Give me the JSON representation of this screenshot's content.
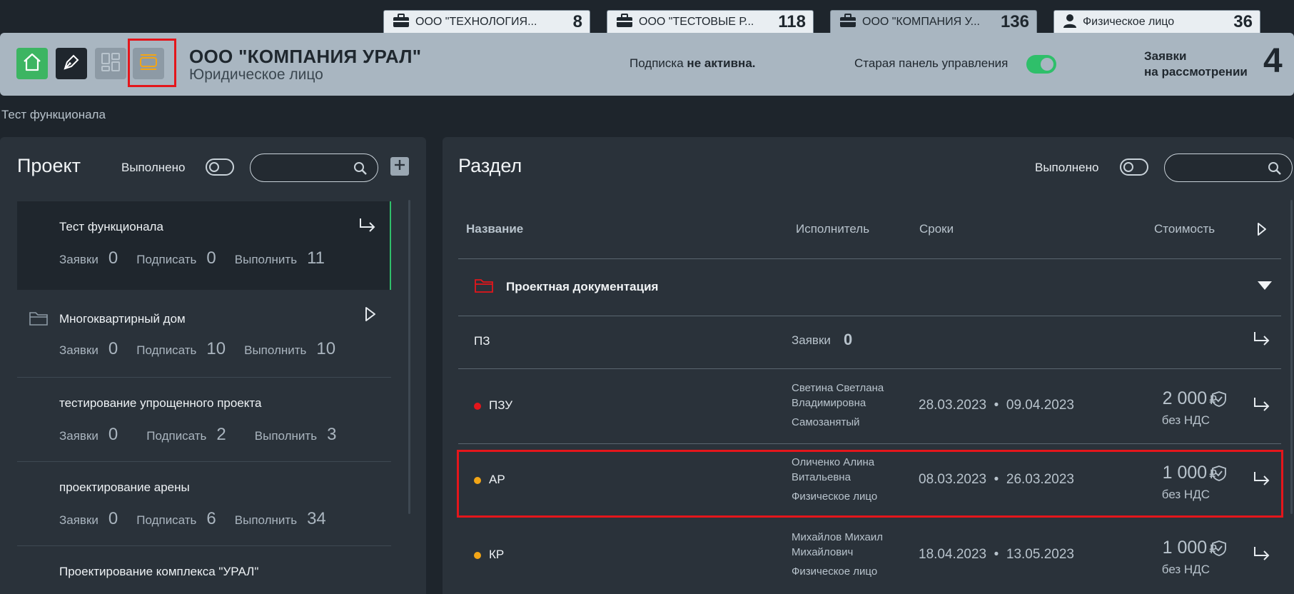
{
  "org_tabs": [
    {
      "name": "ООО \"ТЕХНОЛОГИЯ...",
      "count": "8",
      "icon": "briefcase-icon",
      "active": false
    },
    {
      "name": "ООО \"ТЕСТОВЫЕ Р...",
      "count": "118",
      "icon": "briefcase-icon",
      "active": false
    },
    {
      "name": "ООО \"КОМПАНИЯ У...",
      "count": "136",
      "icon": "briefcase-icon",
      "active": true
    },
    {
      "name": "Физическое лицо",
      "count": "36",
      "icon": "person-icon",
      "active": false
    }
  ],
  "header": {
    "org_name": "ООО \"КОМПАНИЯ УРАЛ\"",
    "org_type": "Юридическое лицо",
    "subscription_prefix": "Подписка",
    "subscription_status": "не активна.",
    "old_panel_label": "Старая панель управления",
    "requests_label_1": "Заявки",
    "requests_label_2": "на рассмотрении",
    "requests_count": "4",
    "buttons": [
      "home-icon",
      "pen-icon",
      "dashboard-grid-icon",
      "card-view-icon"
    ]
  },
  "breadcrumb": "Тест функционала",
  "project_panel": {
    "title": "Проект",
    "done_label": "Выполнено",
    "search_placeholder": "",
    "items": [
      {
        "name": "Тест функционала",
        "requests_label": "Заявки",
        "requests": "0",
        "sign_label": "Подписать",
        "sign": "0",
        "do_label": "Выполнить",
        "do": "11",
        "selected": true,
        "folder": false
      },
      {
        "name": "Многоквартирный дом",
        "requests_label": "Заявки",
        "requests": "0",
        "sign_label": "Подписать",
        "sign": "10",
        "do_label": "Выполнить",
        "do": "10",
        "selected": false,
        "folder": true
      },
      {
        "name": "тестирование упрощенного проекта",
        "requests_label": "Заявки",
        "requests": "0",
        "sign_label": "Подписать",
        "sign": "2",
        "do_label": "Выполнить",
        "do": "3",
        "selected": false,
        "folder": false
      },
      {
        "name": "проектирование арены",
        "requests_label": "Заявки",
        "requests": "0",
        "sign_label": "Подписать",
        "sign": "6",
        "do_label": "Выполнить",
        "do": "34",
        "selected": false,
        "folder": false
      },
      {
        "name": "Проектирование комплекса \"УРАЛ\"",
        "selected": false,
        "folder": false
      }
    ]
  },
  "section_panel": {
    "title": "Раздел",
    "done_label": "Выполнено",
    "search_placeholder": "",
    "columns": {
      "name": "Название",
      "executor": "Исполнитель",
      "terms": "Сроки",
      "cost": "Стоимость"
    },
    "group": "Проектная документация",
    "pz": {
      "name": "ПЗ",
      "requests_label": "Заявки",
      "requests": "0"
    },
    "rows": [
      {
        "name": "ПЗУ",
        "status_color": "#e4161b",
        "executor_1": "Светина Светлана",
        "executor_2": "Владимировна",
        "executor_type": "Самозанятый",
        "date_from": "28.03.2023",
        "date_to": "09.04.2023",
        "price": "2 000",
        "currency": "₽",
        "vat": "без НДС"
      },
      {
        "name": "АР",
        "status_color": "#f2a516",
        "executor_1": "Оличенко Алина",
        "executor_2": "Витальевна",
        "executor_type": "Физическое лицо",
        "date_from": "08.03.2023",
        "date_to": "26.03.2023",
        "price": "1 000",
        "currency": "₽",
        "vat": "без НДС"
      },
      {
        "name": "КР",
        "status_color": "#f2a516",
        "executor_1": "Михайлов Михаил",
        "executor_2": "Михайлович",
        "executor_type": "Физическое лицо",
        "date_from": "18.04.2023",
        "date_to": "13.05.2023",
        "price": "1 000",
        "currency": "₽",
        "vat": "без НДС"
      }
    ]
  },
  "colors": {
    "accent_green": "#2fbf6a",
    "highlight_red": "#e4161b",
    "header_bg": "#a9b6c1",
    "panel_bg": "#2a323a"
  }
}
